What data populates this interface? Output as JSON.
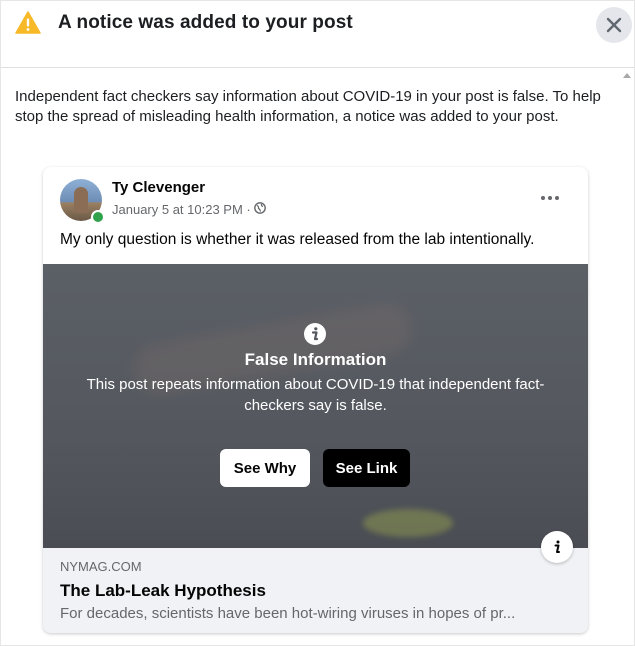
{
  "dialog": {
    "title": "A notice was added to your post",
    "warning_icon": "warning-triangle-icon",
    "close_icon": "close-icon"
  },
  "notice": {
    "text": "Independent fact checkers say information about COVID-19 in your post is false. To help stop the spread of misleading health information, a notice was added to your post."
  },
  "post": {
    "author": "Ty Clevenger",
    "date": "January 5 at 10:23 PM · ",
    "privacy_icon": "globe-icon",
    "text": "My only question is whether it was released from the lab intentionally.",
    "overlay": {
      "title": "False Information",
      "description": "This post repeats information about COVID-19 that independent fact-checkers say is false.",
      "see_why_label": "See Why",
      "see_link_label": "See Link"
    },
    "link": {
      "domain": "NYMAG.COM",
      "title": "The Lab-Leak Hypothesis",
      "description": "For decades, scientists have been hot-wiring viruses in hopes of pr..."
    }
  },
  "colors": {
    "warning": "#f7b928",
    "online": "#31a24c",
    "close_bg": "#e4e6eb",
    "link_bg": "#f0f2f5"
  }
}
